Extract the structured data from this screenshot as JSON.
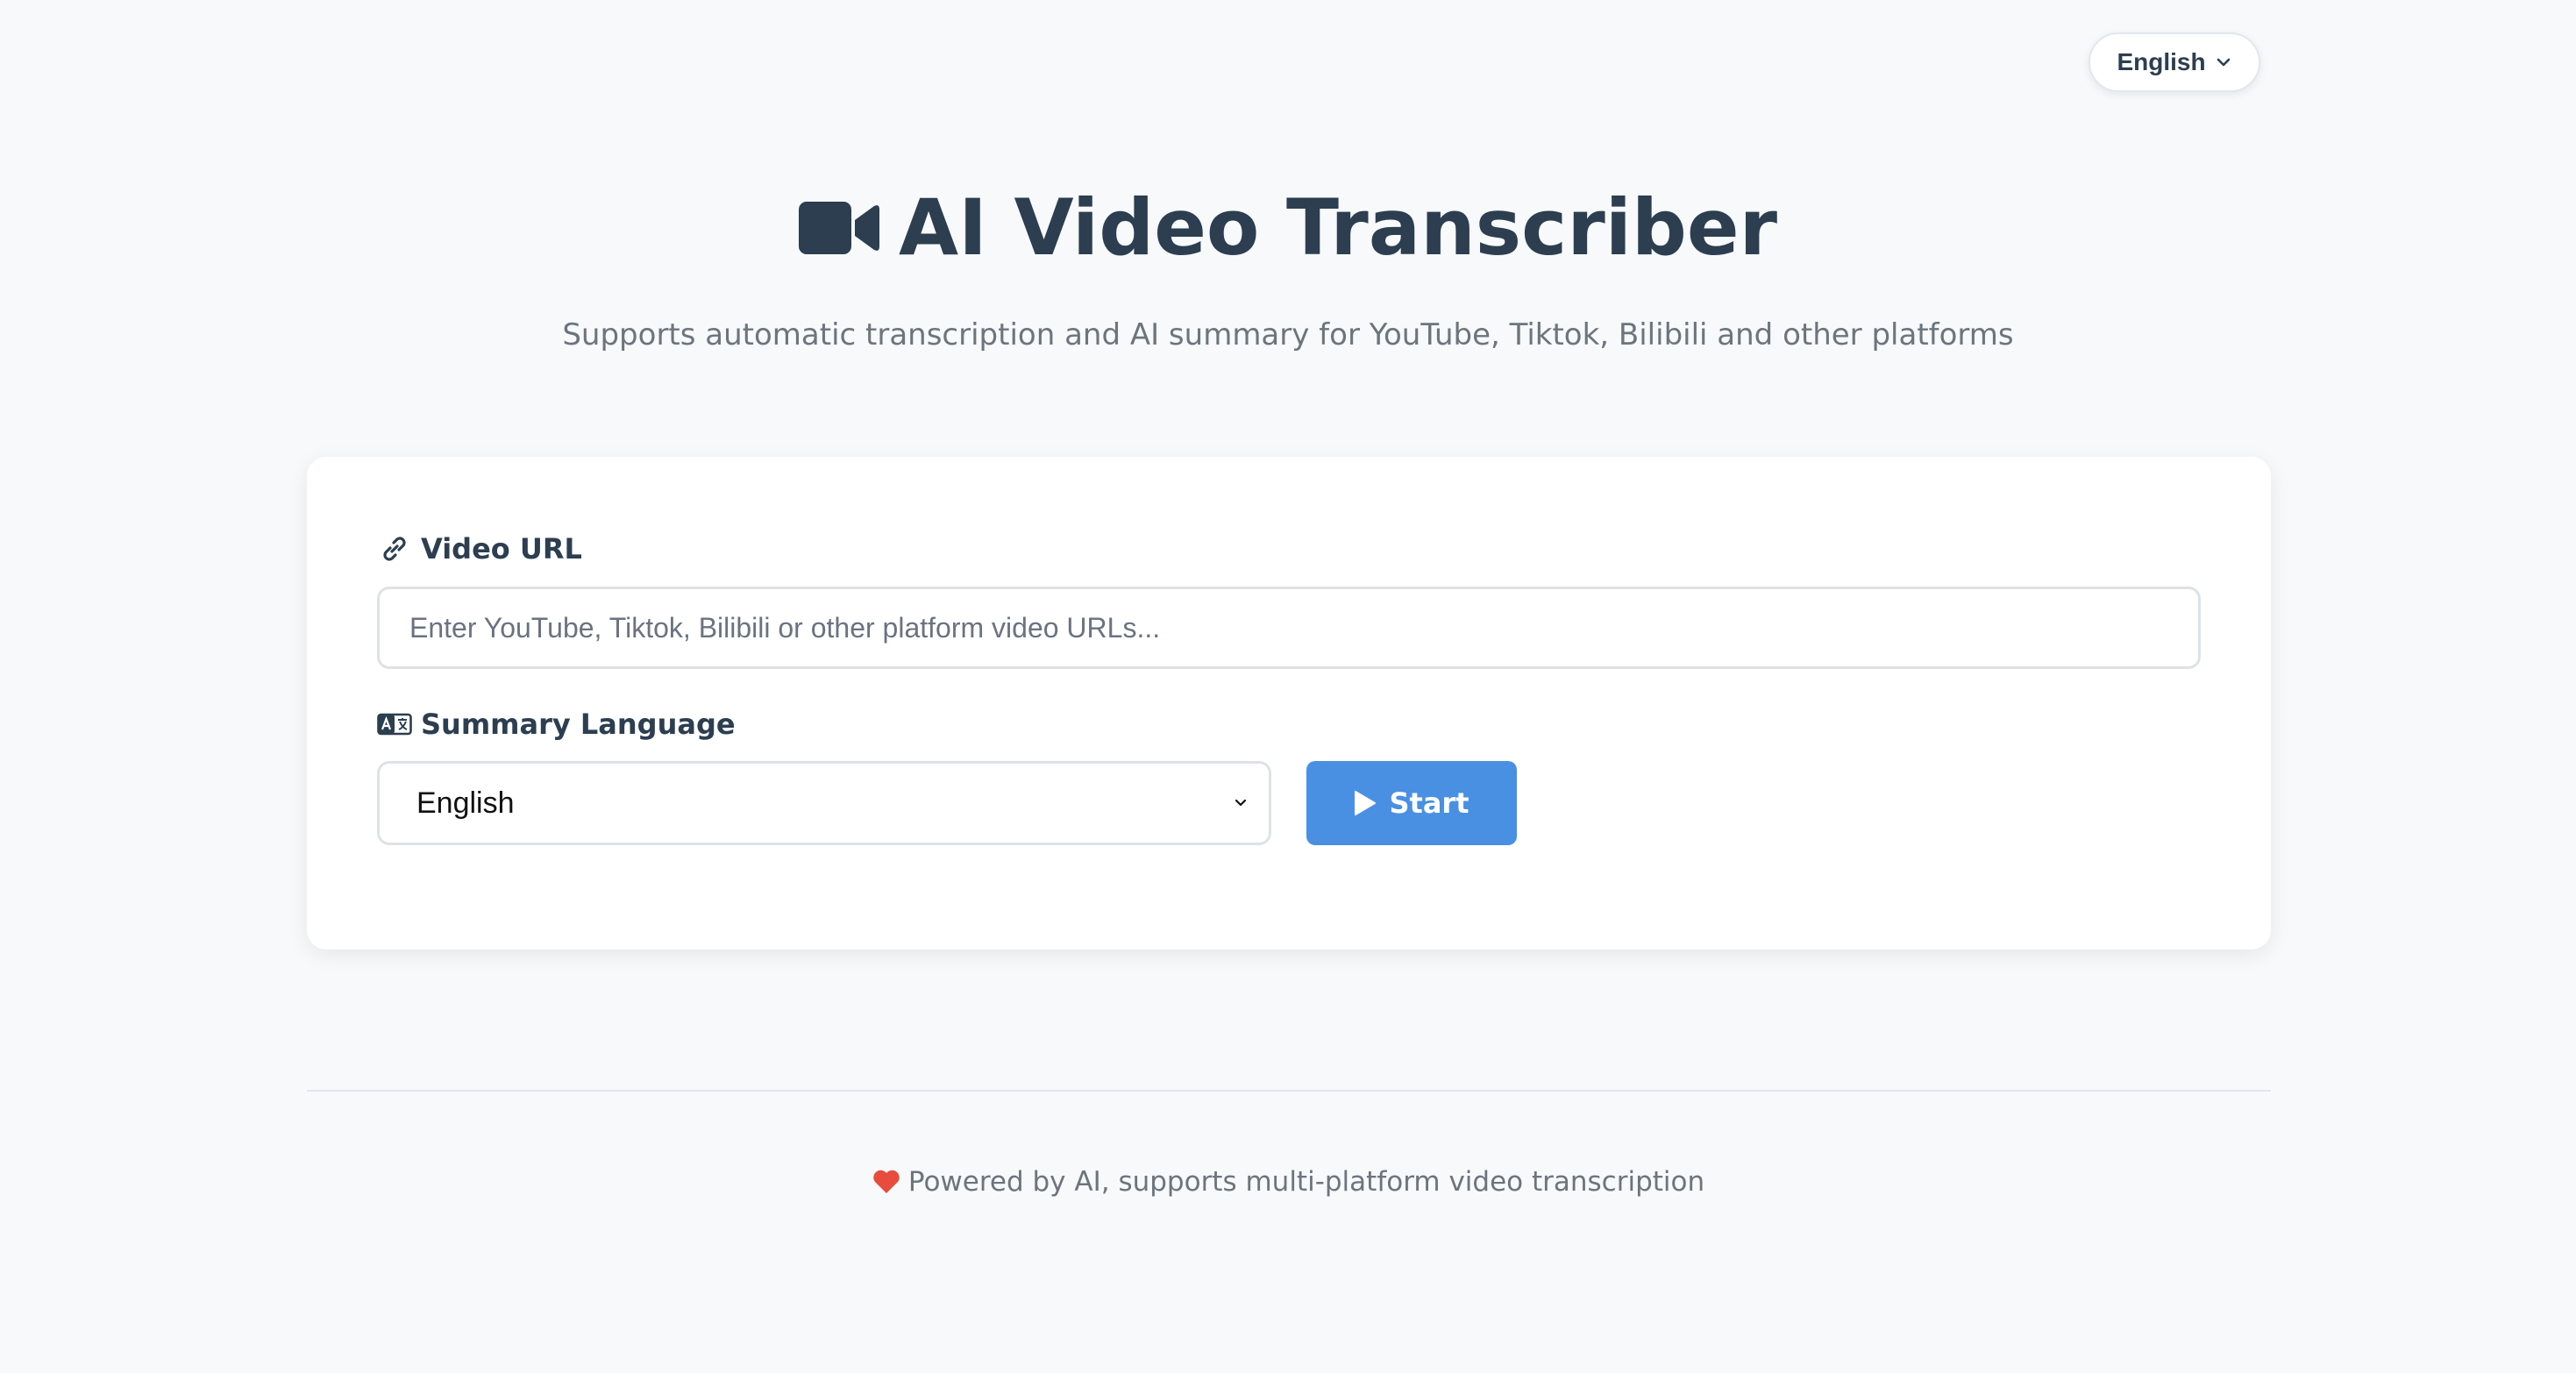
{
  "language_switcher": {
    "label": "English",
    "icon": "chevron-down-icon"
  },
  "header": {
    "icon": "video-camera-icon",
    "title": "AI Video Transcriber",
    "subtitle": "Supports automatic transcription and AI summary for YouTube, Tiktok, Bilibili and other platforms"
  },
  "form": {
    "url_label": "Video URL",
    "url_icon": "link-icon",
    "url_value": "",
    "url_placeholder": "Enter YouTube, Tiktok, Bilibili or other platform video URLs...",
    "language_label": "Summary Language",
    "language_icon": "language-icon",
    "language_selected": "English",
    "start_label": "Start",
    "start_icon": "play-icon"
  },
  "footer": {
    "icon": "heart-icon",
    "text": "Powered by AI, supports multi-platform video transcription"
  },
  "colors": {
    "background": "#f7f9fb",
    "primary_text": "#2c3e50",
    "muted_text": "#6c757d",
    "accent": "#4a90e2",
    "heart": "#e74c3c"
  }
}
